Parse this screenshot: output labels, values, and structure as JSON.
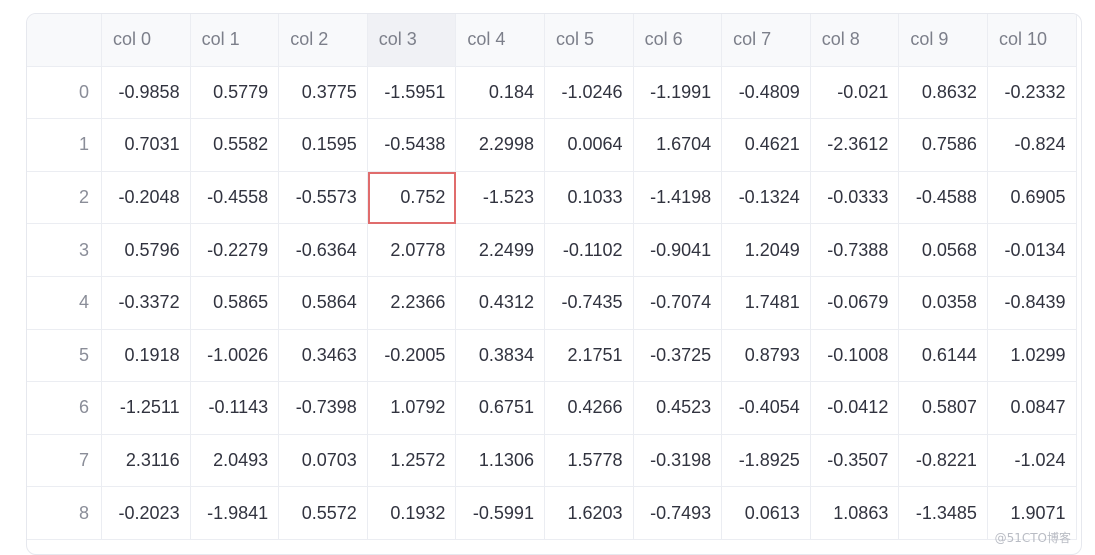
{
  "columns": [
    "col 0",
    "col 1",
    "col 2",
    "col 3",
    "col 4",
    "col 5",
    "col 6",
    "col 7",
    "col 8",
    "col 9",
    "col 10"
  ],
  "rows": [
    {
      "index": "0",
      "cells": [
        "-0.9858",
        "0.5779",
        "0.3775",
        "-1.5951",
        "0.184",
        "-1.0246",
        "-1.1991",
        "-0.4809",
        "-0.021",
        "0.8632",
        "-0.2332"
      ]
    },
    {
      "index": "1",
      "cells": [
        "0.7031",
        "0.5582",
        "0.1595",
        "-0.5438",
        "2.2998",
        "0.0064",
        "1.6704",
        "0.4621",
        "-2.3612",
        "0.7586",
        "-0.824"
      ]
    },
    {
      "index": "2",
      "cells": [
        "-0.2048",
        "-0.4558",
        "-0.5573",
        "0.752",
        "-1.523",
        "0.1033",
        "-1.4198",
        "-0.1324",
        "-0.0333",
        "-0.4588",
        "0.6905"
      ]
    },
    {
      "index": "3",
      "cells": [
        "0.5796",
        "-0.2279",
        "-0.6364",
        "2.0778",
        "2.2499",
        "-0.1102",
        "-0.9041",
        "1.2049",
        "-0.7388",
        "0.0568",
        "-0.0134"
      ]
    },
    {
      "index": "4",
      "cells": [
        "-0.3372",
        "0.5865",
        "0.5864",
        "2.2366",
        "0.4312",
        "-0.7435",
        "-0.7074",
        "1.7481",
        "-0.0679",
        "0.0358",
        "-0.8439"
      ]
    },
    {
      "index": "5",
      "cells": [
        "0.1918",
        "-1.0026",
        "0.3463",
        "-0.2005",
        "0.3834",
        "2.1751",
        "-0.3725",
        "0.8793",
        "-0.1008",
        "0.6144",
        "1.0299"
      ]
    },
    {
      "index": "6",
      "cells": [
        "-1.2511",
        "-0.1143",
        "-0.7398",
        "1.0792",
        "0.6751",
        "0.4266",
        "0.4523",
        "-0.4054",
        "-0.0412",
        "0.5807",
        "0.0847"
      ]
    },
    {
      "index": "7",
      "cells": [
        "2.3116",
        "2.0493",
        "0.0703",
        "1.2572",
        "1.1306",
        "1.5778",
        "-0.3198",
        "-1.8925",
        "-0.3507",
        "-0.8221",
        "-1.024"
      ]
    },
    {
      "index": "8",
      "cells": [
        "-0.2023",
        "-1.9841",
        "0.5572",
        "0.1932",
        "-0.5991",
        "1.6203",
        "-0.7493",
        "0.0613",
        "1.0863",
        "-1.3485",
        "1.9071"
      ]
    }
  ],
  "selected_cell": {
    "row": 2,
    "col": 3
  },
  "active_column": 3,
  "watermark": "@51CTO博客",
  "colors": {
    "selection_border": "#e06c6c",
    "header_bg": "#f8f9fb",
    "grid_line": "#ebedf2",
    "text": "#31333f"
  }
}
